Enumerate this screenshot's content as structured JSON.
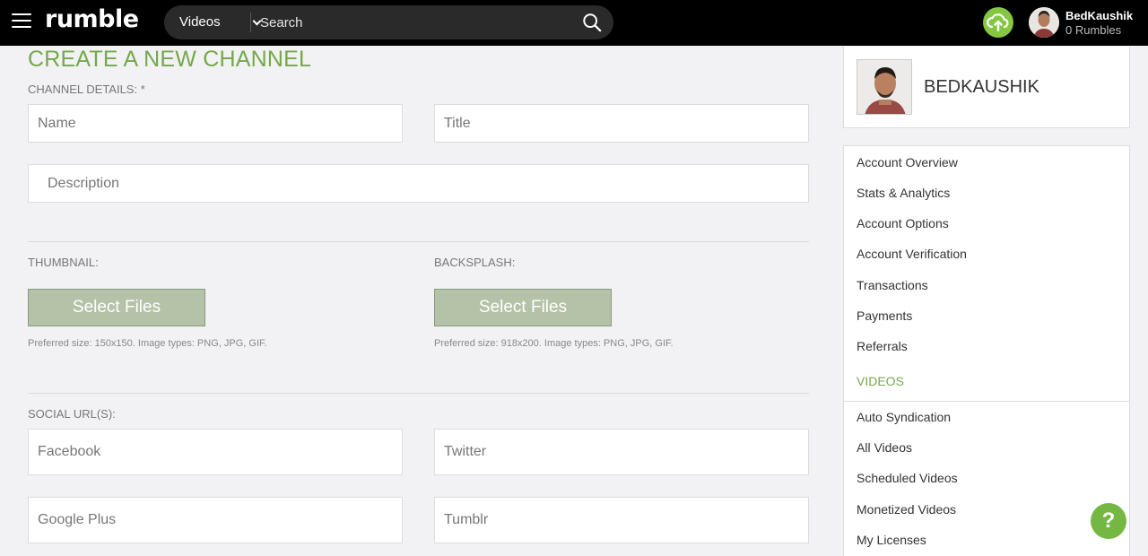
{
  "header": {
    "logo": "rumble",
    "search_category": "Videos",
    "search_placeholder": "Search",
    "user_name": "BedKaushik",
    "user_rumbles": "0 Rumbles",
    "accent": "#85c742"
  },
  "form": {
    "title": "CREATE A NEW CHANNEL",
    "channel_details_label": "CHANNEL DETAILS: *",
    "name_placeholder": "Name",
    "title_placeholder": "Title",
    "description_placeholder": "Description",
    "thumbnail_label": "THUMBNAIL:",
    "backsplash_label": "BACKSPLASH:",
    "select_files_label": "Select Files",
    "thumbnail_hint": "Preferred size: 150x150. Image types: PNG, JPG, GIF.",
    "backsplash_hint": "Preferred size: 918x200. Image types: PNG, JPG, GIF.",
    "social_label": "SOCIAL URL(S):",
    "facebook_placeholder": "Facebook",
    "twitter_placeholder": "Twitter",
    "googleplus_placeholder": "Google Plus",
    "tumblr_placeholder": "Tumblr"
  },
  "sidebar": {
    "profile_name": "BEDKAUSHIK",
    "account_items": [
      "Account Overview",
      "Stats & Analytics",
      "Account Options",
      "Account Verification",
      "Transactions",
      "Payments",
      "Referrals"
    ],
    "videos_heading": "VIDEOS",
    "video_items": [
      "Auto Syndication",
      "All Videos",
      "Scheduled Videos",
      "Monetized Videos",
      "My Licenses"
    ]
  },
  "help_label": "?"
}
